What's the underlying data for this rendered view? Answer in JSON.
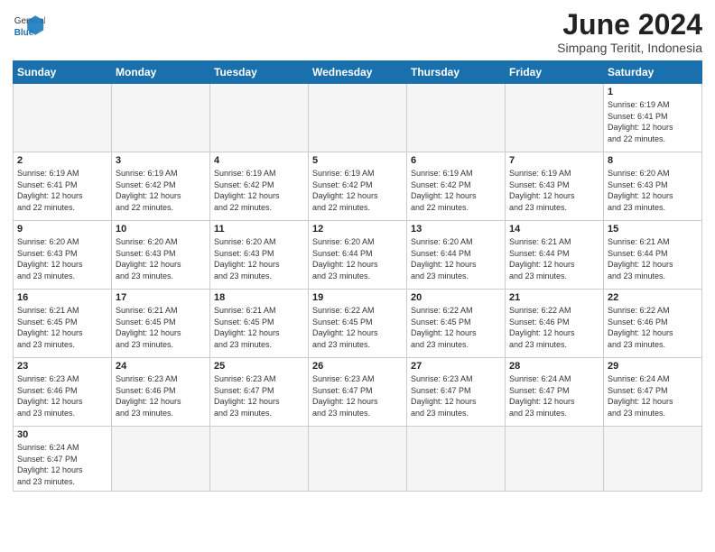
{
  "logo": {
    "text_general": "General",
    "text_blue": "Blue"
  },
  "title": "June 2024",
  "subtitle": "Simpang Teritit, Indonesia",
  "days_header": [
    "Sunday",
    "Monday",
    "Tuesday",
    "Wednesday",
    "Thursday",
    "Friday",
    "Saturday"
  ],
  "weeks": [
    [
      {
        "day": "",
        "info": "",
        "empty": true
      },
      {
        "day": "",
        "info": "",
        "empty": true
      },
      {
        "day": "",
        "info": "",
        "empty": true
      },
      {
        "day": "",
        "info": "",
        "empty": true
      },
      {
        "day": "",
        "info": "",
        "empty": true
      },
      {
        "day": "",
        "info": "",
        "empty": true
      },
      {
        "day": "1",
        "info": "Sunrise: 6:19 AM\nSunset: 6:41 PM\nDaylight: 12 hours\nand 22 minutes."
      }
    ],
    [
      {
        "day": "2",
        "info": "Sunrise: 6:19 AM\nSunset: 6:41 PM\nDaylight: 12 hours\nand 22 minutes."
      },
      {
        "day": "3",
        "info": "Sunrise: 6:19 AM\nSunset: 6:42 PM\nDaylight: 12 hours\nand 22 minutes."
      },
      {
        "day": "4",
        "info": "Sunrise: 6:19 AM\nSunset: 6:42 PM\nDaylight: 12 hours\nand 22 minutes."
      },
      {
        "day": "5",
        "info": "Sunrise: 6:19 AM\nSunset: 6:42 PM\nDaylight: 12 hours\nand 22 minutes."
      },
      {
        "day": "6",
        "info": "Sunrise: 6:19 AM\nSunset: 6:42 PM\nDaylight: 12 hours\nand 22 minutes."
      },
      {
        "day": "7",
        "info": "Sunrise: 6:19 AM\nSunset: 6:43 PM\nDaylight: 12 hours\nand 23 minutes."
      },
      {
        "day": "8",
        "info": "Sunrise: 6:20 AM\nSunset: 6:43 PM\nDaylight: 12 hours\nand 23 minutes."
      }
    ],
    [
      {
        "day": "9",
        "info": "Sunrise: 6:20 AM\nSunset: 6:43 PM\nDaylight: 12 hours\nand 23 minutes."
      },
      {
        "day": "10",
        "info": "Sunrise: 6:20 AM\nSunset: 6:43 PM\nDaylight: 12 hours\nand 23 minutes."
      },
      {
        "day": "11",
        "info": "Sunrise: 6:20 AM\nSunset: 6:43 PM\nDaylight: 12 hours\nand 23 minutes."
      },
      {
        "day": "12",
        "info": "Sunrise: 6:20 AM\nSunset: 6:44 PM\nDaylight: 12 hours\nand 23 minutes."
      },
      {
        "day": "13",
        "info": "Sunrise: 6:20 AM\nSunset: 6:44 PM\nDaylight: 12 hours\nand 23 minutes."
      },
      {
        "day": "14",
        "info": "Sunrise: 6:21 AM\nSunset: 6:44 PM\nDaylight: 12 hours\nand 23 minutes."
      },
      {
        "day": "15",
        "info": "Sunrise: 6:21 AM\nSunset: 6:44 PM\nDaylight: 12 hours\nand 23 minutes."
      }
    ],
    [
      {
        "day": "16",
        "info": "Sunrise: 6:21 AM\nSunset: 6:45 PM\nDaylight: 12 hours\nand 23 minutes."
      },
      {
        "day": "17",
        "info": "Sunrise: 6:21 AM\nSunset: 6:45 PM\nDaylight: 12 hours\nand 23 minutes."
      },
      {
        "day": "18",
        "info": "Sunrise: 6:21 AM\nSunset: 6:45 PM\nDaylight: 12 hours\nand 23 minutes."
      },
      {
        "day": "19",
        "info": "Sunrise: 6:22 AM\nSunset: 6:45 PM\nDaylight: 12 hours\nand 23 minutes."
      },
      {
        "day": "20",
        "info": "Sunrise: 6:22 AM\nSunset: 6:45 PM\nDaylight: 12 hours\nand 23 minutes."
      },
      {
        "day": "21",
        "info": "Sunrise: 6:22 AM\nSunset: 6:46 PM\nDaylight: 12 hours\nand 23 minutes."
      },
      {
        "day": "22",
        "info": "Sunrise: 6:22 AM\nSunset: 6:46 PM\nDaylight: 12 hours\nand 23 minutes."
      }
    ],
    [
      {
        "day": "23",
        "info": "Sunrise: 6:23 AM\nSunset: 6:46 PM\nDaylight: 12 hours\nand 23 minutes."
      },
      {
        "day": "24",
        "info": "Sunrise: 6:23 AM\nSunset: 6:46 PM\nDaylight: 12 hours\nand 23 minutes."
      },
      {
        "day": "25",
        "info": "Sunrise: 6:23 AM\nSunset: 6:47 PM\nDaylight: 12 hours\nand 23 minutes."
      },
      {
        "day": "26",
        "info": "Sunrise: 6:23 AM\nSunset: 6:47 PM\nDaylight: 12 hours\nand 23 minutes."
      },
      {
        "day": "27",
        "info": "Sunrise: 6:23 AM\nSunset: 6:47 PM\nDaylight: 12 hours\nand 23 minutes."
      },
      {
        "day": "28",
        "info": "Sunrise: 6:24 AM\nSunset: 6:47 PM\nDaylight: 12 hours\nand 23 minutes."
      },
      {
        "day": "29",
        "info": "Sunrise: 6:24 AM\nSunset: 6:47 PM\nDaylight: 12 hours\nand 23 minutes."
      }
    ],
    [
      {
        "day": "30",
        "info": "Sunrise: 6:24 AM\nSunset: 6:47 PM\nDaylight: 12 hours\nand 23 minutes.",
        "last": true
      },
      {
        "day": "",
        "info": "",
        "empty": true,
        "last": true
      },
      {
        "day": "",
        "info": "",
        "empty": true,
        "last": true
      },
      {
        "day": "",
        "info": "",
        "empty": true,
        "last": true
      },
      {
        "day": "",
        "info": "",
        "empty": true,
        "last": true
      },
      {
        "day": "",
        "info": "",
        "empty": true,
        "last": true
      },
      {
        "day": "",
        "info": "",
        "empty": true,
        "last": true
      }
    ]
  ]
}
